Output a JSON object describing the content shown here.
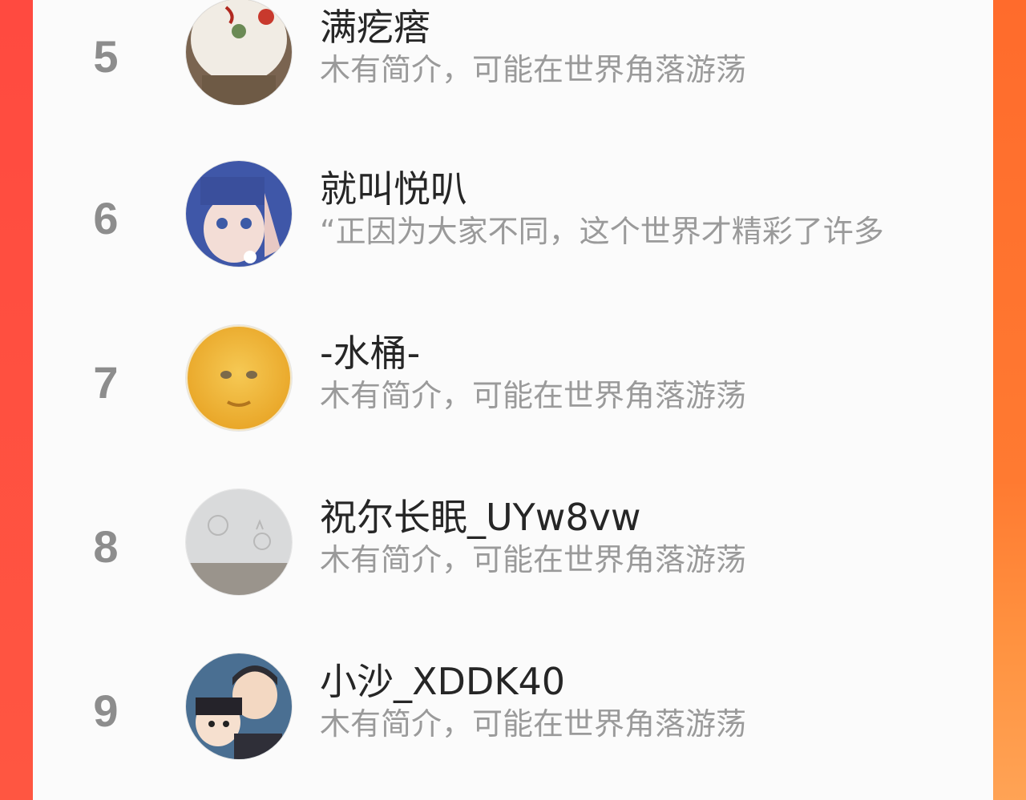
{
  "ranking": {
    "rows": [
      {
        "rank": "5",
        "name": "满疙瘩",
        "bio": "木有简介，可能在世界角落游荡"
      },
      {
        "rank": "6",
        "name": "就叫悦叭",
        "bio": "“正因为大家不同，这个世界才精彩了许多"
      },
      {
        "rank": "7",
        "name": "-水桶-",
        "bio": "木有简介，可能在世界角落游荡"
      },
      {
        "rank": "8",
        "name": "祝尔长眠_UYw8vw",
        "bio": "木有简介，可能在世界角落游荡"
      },
      {
        "rank": "9",
        "name": "小沙_XDDK40",
        "bio": "木有简介，可能在世界角落游荡"
      }
    ]
  },
  "colors": {
    "card_bg": "#fbfbfb",
    "rank": "#8d8d8d",
    "name": "#262626",
    "bio": "#9a9a9a",
    "frame_left": "#ff4a40",
    "frame_right": "#ff7a31"
  }
}
